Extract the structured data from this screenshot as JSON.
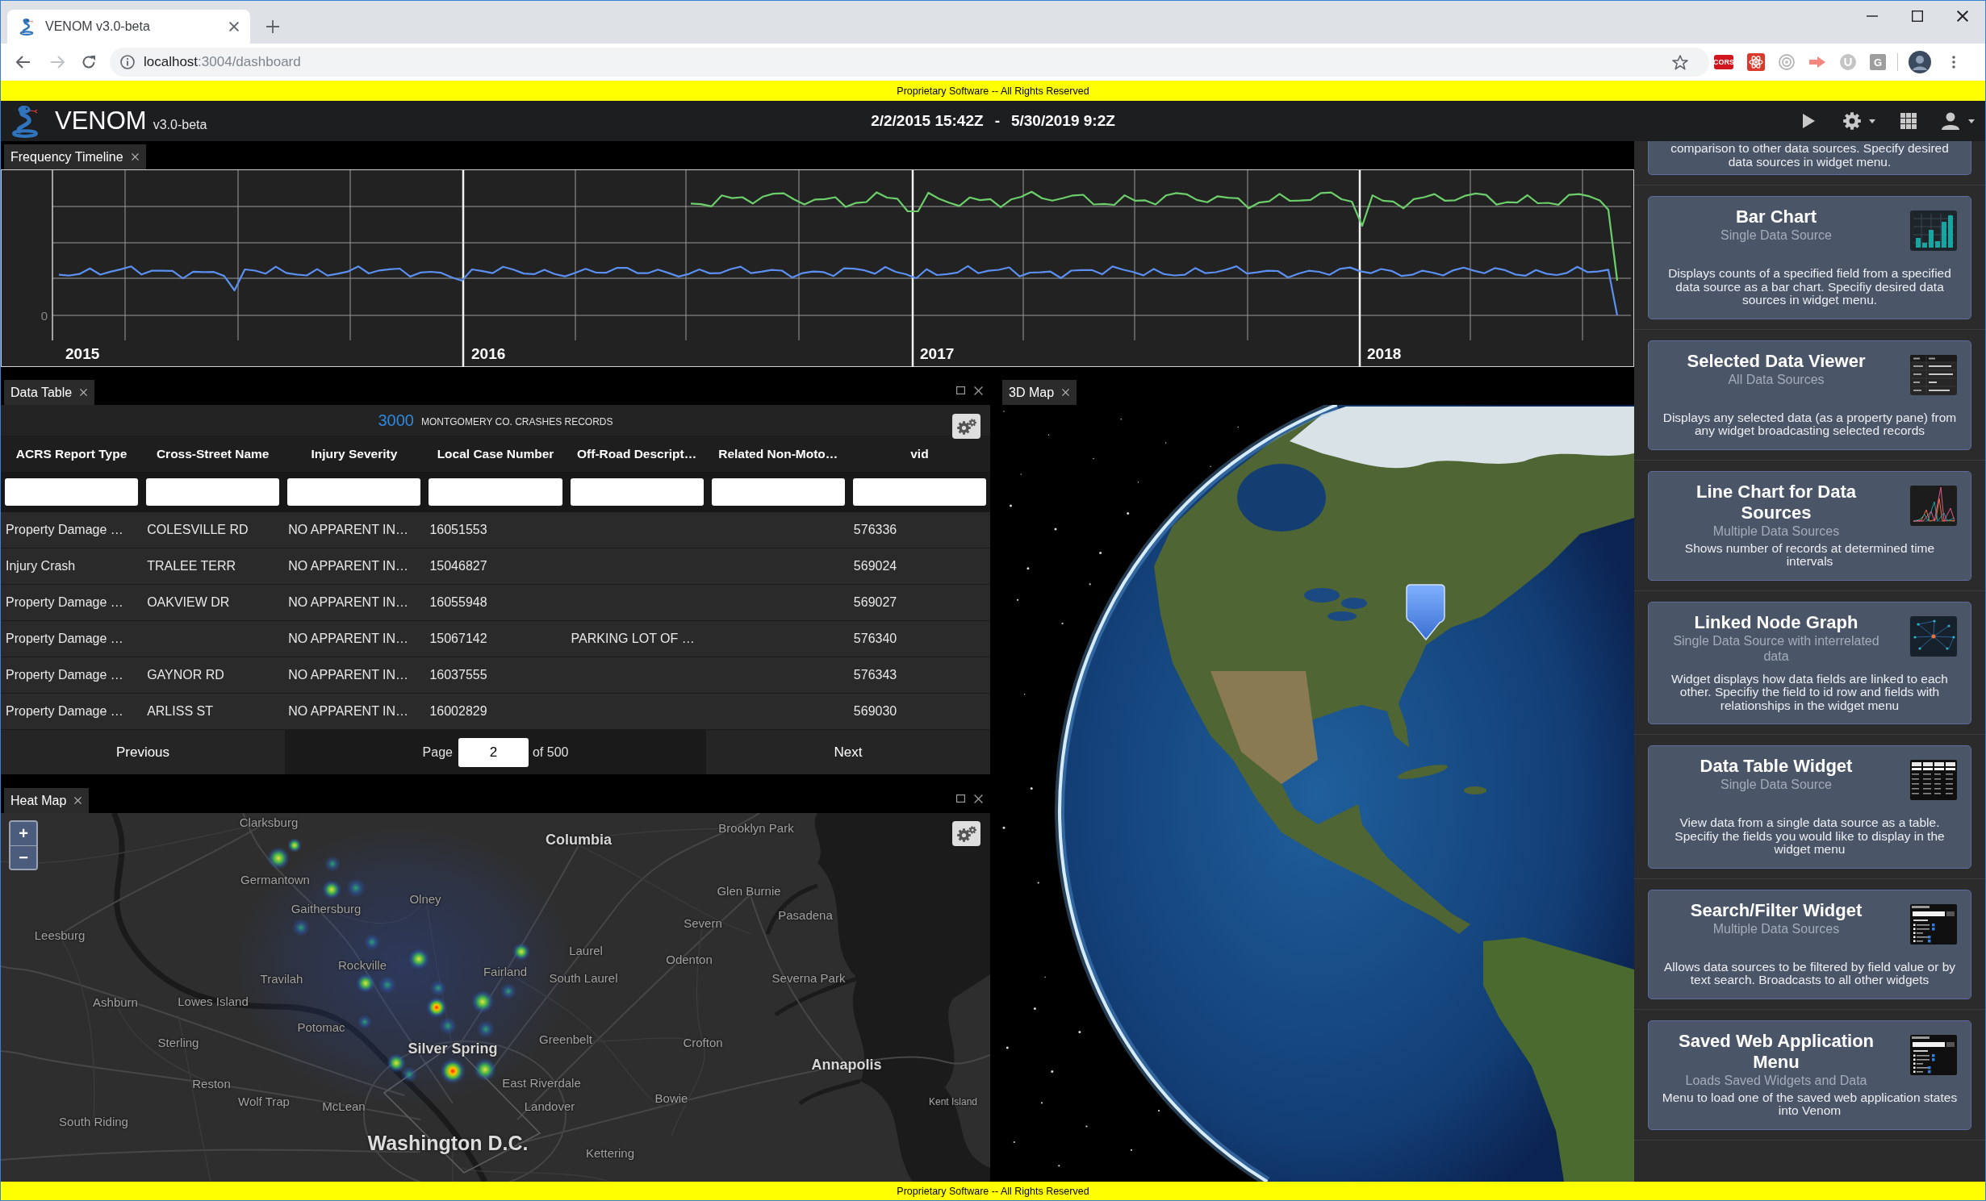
{
  "browser": {
    "tab_title": "VENOM v3.0-beta",
    "url_host": "localhost",
    "url_path": ":3004/dashboard",
    "forward_disabled": true,
    "extensions": [
      {
        "kind": "cors",
        "label": "CORS"
      },
      {
        "kind": "atom"
      },
      {
        "kind": "target"
      },
      {
        "kind": "arrow"
      },
      {
        "kind": "ucircle"
      },
      {
        "kind": "letter",
        "label": "G"
      }
    ]
  },
  "top_banner": {
    "text": "Proprietary Software -- All Rights Reserved"
  },
  "header": {
    "app_name": "VENOM",
    "version": "v3.0-beta",
    "range_start": "2/2/2015 15:42Z",
    "range_separator": "-",
    "range_end": "5/30/2019 9:2Z"
  },
  "timeline": {
    "tab": "Frequency Timeline",
    "y_tick": "0",
    "years": [
      "2015",
      "2016",
      "2017",
      "2018"
    ]
  },
  "data_table": {
    "tab": "Data Table",
    "record_count": "3000",
    "source": "MONTGOMERY CO. CRASHES RECORDS",
    "columns": [
      "ACRS Report Type",
      "Cross-Street Name",
      "Injury Severity",
      "Local Case Number",
      "Off-Road Descript…",
      "Related Non-Moto…",
      "vid"
    ],
    "rows": [
      [
        "Property Damage …",
        "COLESVILLE RD",
        "NO APPARENT IN…",
        "16051553",
        null,
        null,
        "576336"
      ],
      [
        "Injury Crash",
        "TRALEE TERR",
        "NO APPARENT IN…",
        "15046827",
        null,
        null,
        "569024"
      ],
      [
        "Property Damage …",
        "OAKVIEW DR",
        "NO APPARENT IN…",
        "16055948",
        null,
        null,
        "569027"
      ],
      [
        "Property Damage …",
        null,
        "NO APPARENT IN…",
        "15067142",
        "PARKING LOT OF …",
        null,
        "576340"
      ],
      [
        "Property Damage …",
        "GAYNOR RD",
        "NO APPARENT IN…",
        "16037555",
        null,
        null,
        "576343"
      ],
      [
        "Property Damage …",
        "ARLISS ST",
        "NO APPARENT IN…",
        "16002829",
        null,
        null,
        "569030"
      ]
    ],
    "pagination": {
      "previous": "Previous",
      "page_label": "Page",
      "page": "2",
      "page_total": "of 500",
      "next": "Next"
    }
  },
  "globe_map": {
    "tab": "3D Map"
  },
  "heat_map": {
    "tab": "Heat Map",
    "zoom_in": "+",
    "zoom_out": "−",
    "places": [
      {
        "name": "Clarksburg",
        "kind": "town"
      },
      {
        "name": "Columbia",
        "kind": "city"
      },
      {
        "name": "Brooklyn Park",
        "kind": "town"
      },
      {
        "name": "Germantown",
        "kind": "town"
      },
      {
        "name": "Gaithersburg",
        "kind": "town"
      },
      {
        "name": "Olney",
        "kind": "town"
      },
      {
        "name": "Glen Burnie",
        "kind": "town"
      },
      {
        "name": "Pasadena",
        "kind": "town"
      },
      {
        "name": "Leesburg",
        "kind": "town"
      },
      {
        "name": "Severn",
        "kind": "town"
      },
      {
        "name": "Laurel",
        "kind": "town"
      },
      {
        "name": "Odenton",
        "kind": "town"
      },
      {
        "name": "Travilah",
        "kind": "town"
      },
      {
        "name": "Rockville",
        "kind": "town"
      },
      {
        "name": "Fairland",
        "kind": "town"
      },
      {
        "name": "South Laurel",
        "kind": "town"
      },
      {
        "name": "Severna Park",
        "kind": "town"
      },
      {
        "name": "Ashburn",
        "kind": "town"
      },
      {
        "name": "Lowes Island",
        "kind": "town"
      },
      {
        "name": "Potomac",
        "kind": "town"
      },
      {
        "name": "Sterling",
        "kind": "town"
      },
      {
        "name": "Greenbelt",
        "kind": "town"
      },
      {
        "name": "Crofton",
        "kind": "town"
      },
      {
        "name": "Silver Spring",
        "kind": "city"
      },
      {
        "name": "Annapolis",
        "kind": "city"
      },
      {
        "name": "Reston",
        "kind": "town"
      },
      {
        "name": "East Riverdale",
        "kind": "town"
      },
      {
        "name": "Wolf Trap",
        "kind": "town"
      },
      {
        "name": "McLean",
        "kind": "town"
      },
      {
        "name": "Landover",
        "kind": "town"
      },
      {
        "name": "Bowie",
        "kind": "town"
      },
      {
        "name": "Kent Island",
        "kind": "minor"
      },
      {
        "name": "South Riding",
        "kind": "town"
      },
      {
        "name": "Washington D.C.",
        "kind": "major"
      },
      {
        "name": "Kettering",
        "kind": "town"
      }
    ]
  },
  "widget_menu": {
    "cards": [
      {
        "kind": "partial",
        "description": "comparison to other data sources. Specify desired data sources in widget menu."
      },
      {
        "kind": "bar_chart",
        "title": "Bar Chart",
        "subtitle": "Single Data Source",
        "description": "Displays counts of a specified field from a specified data source as a bar chart. Specifiy desired data sources in widget menu."
      },
      {
        "kind": "property_pane",
        "title": "Selected Data Viewer",
        "subtitle": "All Data Sources",
        "description": "Displays any selected data (as a property pane) from any widget broadcasting selected records"
      },
      {
        "kind": "line_chart",
        "title": "Line Chart for Data Sources",
        "subtitle": "Multiple Data Sources",
        "description": "Shows number of records at determined time intervals"
      },
      {
        "kind": "node_graph",
        "title": "Linked Node Graph",
        "subtitle": "Single Data Source with interrelated data",
        "description": "Widget displays how data fields are linked to each other. Specifiy the field to id row and fields with relationships in the widget menu"
      },
      {
        "kind": "data_table",
        "title": "Data Table Widget",
        "subtitle": "Single Data Source",
        "description": "View data from a single data source as a table. Specifiy the fields you would like to display in the widget menu"
      },
      {
        "kind": "search_filter",
        "title": "Search/Filter Widget",
        "subtitle": "Multiple Data Sources",
        "description": "Allows data sources to be filtered by field value or by text search. Broadcasts to all other widgets"
      },
      {
        "kind": "search_filter",
        "title": "Saved Web Application Menu",
        "subtitle": "Loads Saved Widgets and Data",
        "description": "Menu to load one of the saved web application states into Venom"
      }
    ]
  },
  "bottom_banner": {
    "text": "Proprietary Software -- All Rights Reserved"
  }
}
